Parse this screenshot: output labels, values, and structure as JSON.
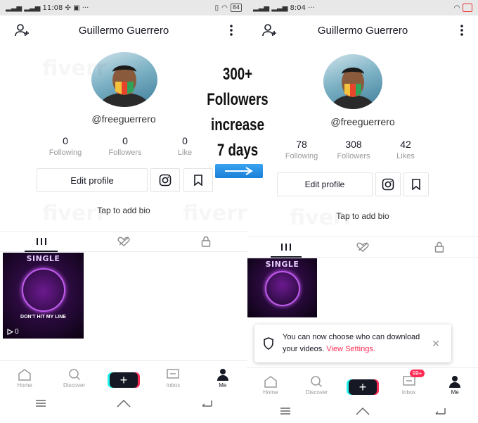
{
  "left": {
    "status": {
      "time": "11:08",
      "signal": "  ",
      "battery": "84"
    },
    "header": {
      "title": "Guillermo Guerrero"
    },
    "profile": {
      "username": "@freeguerrero"
    },
    "stats": [
      {
        "num": "0",
        "label": "Following"
      },
      {
        "num": "0",
        "label": "Followers"
      },
      {
        "num": "0",
        "label": "Like"
      }
    ],
    "edit_label": "Edit profile",
    "bio": "Tap to add bio",
    "video": {
      "single": "SINGLE",
      "title": "DON'T HIT MY LINE",
      "plays": "0"
    },
    "nav": [
      "Home",
      "Discover",
      "",
      "Inbox",
      "Me"
    ]
  },
  "right": {
    "status": {
      "time": "8:04"
    },
    "header": {
      "title": "Guillermo Guerrero"
    },
    "profile": {
      "username": "@freeguerrero"
    },
    "stats": [
      {
        "num": "78",
        "label": "Following"
      },
      {
        "num": "308",
        "label": "Followers"
      },
      {
        "num": "42",
        "label": "Likes"
      }
    ],
    "edit_label": "Edit profile",
    "bio": "Tap to add bio",
    "video": {
      "single": "SINGLE"
    },
    "toast": {
      "text": "You can now choose who can download your videos. ",
      "link": "View Settings."
    },
    "nav": [
      "Home",
      "Discover",
      "",
      "Inbox",
      "Me"
    ],
    "inbox_badge": "99+"
  },
  "promo": {
    "line1": "300+ Followers",
    "line2": "increase",
    "line3": "7 days"
  },
  "colors": {
    "accent": "#fe2c55",
    "cyan": "#25f4ee",
    "arrow": "#1a7fd8"
  }
}
